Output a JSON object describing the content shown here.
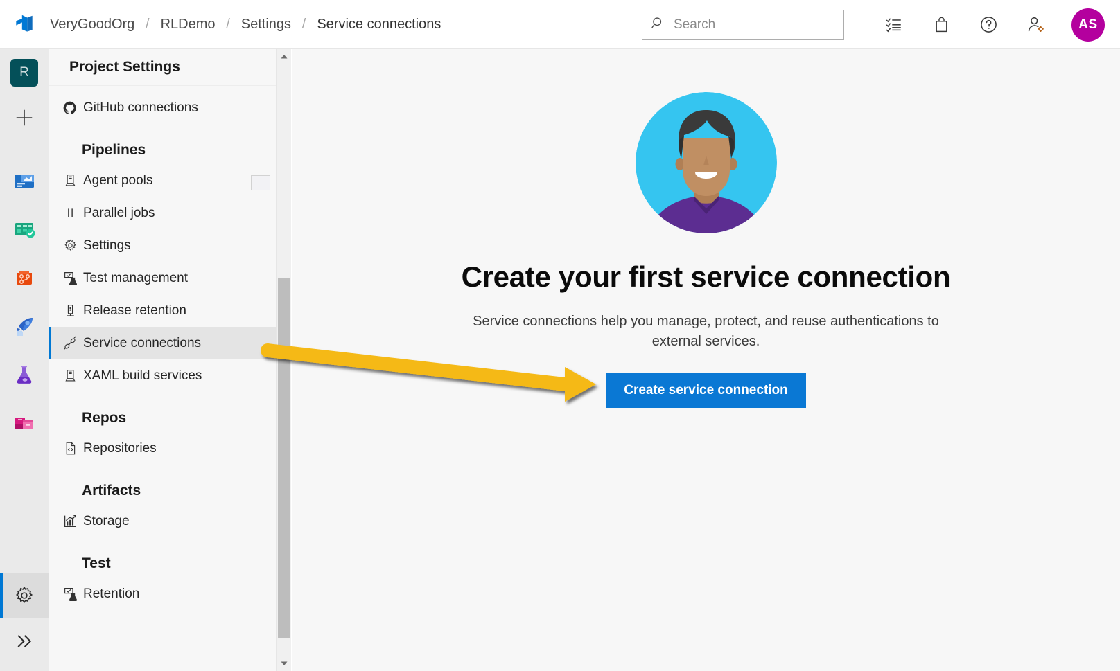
{
  "header": {
    "logo_icon": "azure-devops-logo-icon",
    "breadcrumb": [
      {
        "label": "VeryGoodOrg"
      },
      {
        "label": "RLDemo"
      },
      {
        "label": "Settings"
      },
      {
        "label": "Service connections"
      }
    ],
    "breadcrumb_separator": "/",
    "search": {
      "icon": "search-icon",
      "placeholder": "Search",
      "value": ""
    },
    "icons": [
      {
        "name": "task-list-icon",
        "glyph": "list"
      },
      {
        "name": "marketplace-bag-icon",
        "glyph": "bag"
      },
      {
        "name": "help-icon",
        "glyph": "question"
      },
      {
        "name": "user-settings-icon",
        "glyph": "person-gear"
      }
    ],
    "avatar": {
      "initials": "AS",
      "color": "#b4009e"
    }
  },
  "rail": {
    "project_badge": {
      "label": "R",
      "color": "#045059"
    },
    "add_icon": "plus-icon",
    "items": [
      {
        "name": "overview",
        "icon": "overview-icon"
      },
      {
        "name": "boards",
        "icon": "boards-icon"
      },
      {
        "name": "repos",
        "icon": "repos-icon"
      },
      {
        "name": "pipelines",
        "icon": "pipelines-rocket-icon"
      },
      {
        "name": "test-plans",
        "icon": "test-plans-flask-icon"
      },
      {
        "name": "artifacts",
        "icon": "artifacts-boxes-icon"
      }
    ],
    "settings": {
      "icon": "gear-icon",
      "selected": true
    },
    "expand": {
      "icon": "chevron-double-right-icon"
    }
  },
  "sidebar": {
    "title": "Project Settings",
    "selected": "Service connections",
    "accent": "#0078d4",
    "items": [
      {
        "type": "item",
        "label": "GitHub connections",
        "icon": "github-icon"
      },
      {
        "type": "group",
        "label": "Pipelines"
      },
      {
        "type": "item",
        "label": "Agent pools",
        "icon": "agent-pool-icon"
      },
      {
        "type": "item",
        "label": "Parallel jobs",
        "icon": "parallel-jobs-icon"
      },
      {
        "type": "item",
        "label": "Settings",
        "icon": "gear-icon"
      },
      {
        "type": "item",
        "label": "Test management",
        "icon": "test-management-icon"
      },
      {
        "type": "item",
        "label": "Release retention",
        "icon": "release-retention-icon"
      },
      {
        "type": "item",
        "label": "Service connections",
        "icon": "plug-icon"
      },
      {
        "type": "item",
        "label": "XAML build services",
        "icon": "agent-pool-icon"
      },
      {
        "type": "group",
        "label": "Repos"
      },
      {
        "type": "item",
        "label": "Repositories",
        "icon": "repository-file-icon"
      },
      {
        "type": "group",
        "label": "Artifacts"
      },
      {
        "type": "item",
        "label": "Storage",
        "icon": "storage-chart-icon"
      },
      {
        "type": "group",
        "label": "Test"
      },
      {
        "type": "item",
        "label": "Retention",
        "icon": "test-management-icon"
      }
    ],
    "scrollbar": {
      "up_icon": "scroll-up-icon",
      "down_icon": "scroll-down-icon"
    }
  },
  "main": {
    "illustration": {
      "name": "person-avatar-illustration",
      "circle_color": "#35c5f0",
      "hair_color": "#3a3a3a",
      "skin_color": "#c08f63",
      "shirt_color": "#5c2d91"
    },
    "title": "Create your first service connection",
    "subtitle": "Service connections help you manage, protect, and reuse authentications to external services.",
    "primary_button": {
      "label": "Create service connection",
      "color": "#0a78d4"
    }
  },
  "annotation": {
    "arrow": {
      "name": "highlight-arrow",
      "color": "#f5b912",
      "points_to": "Create service connection"
    }
  }
}
